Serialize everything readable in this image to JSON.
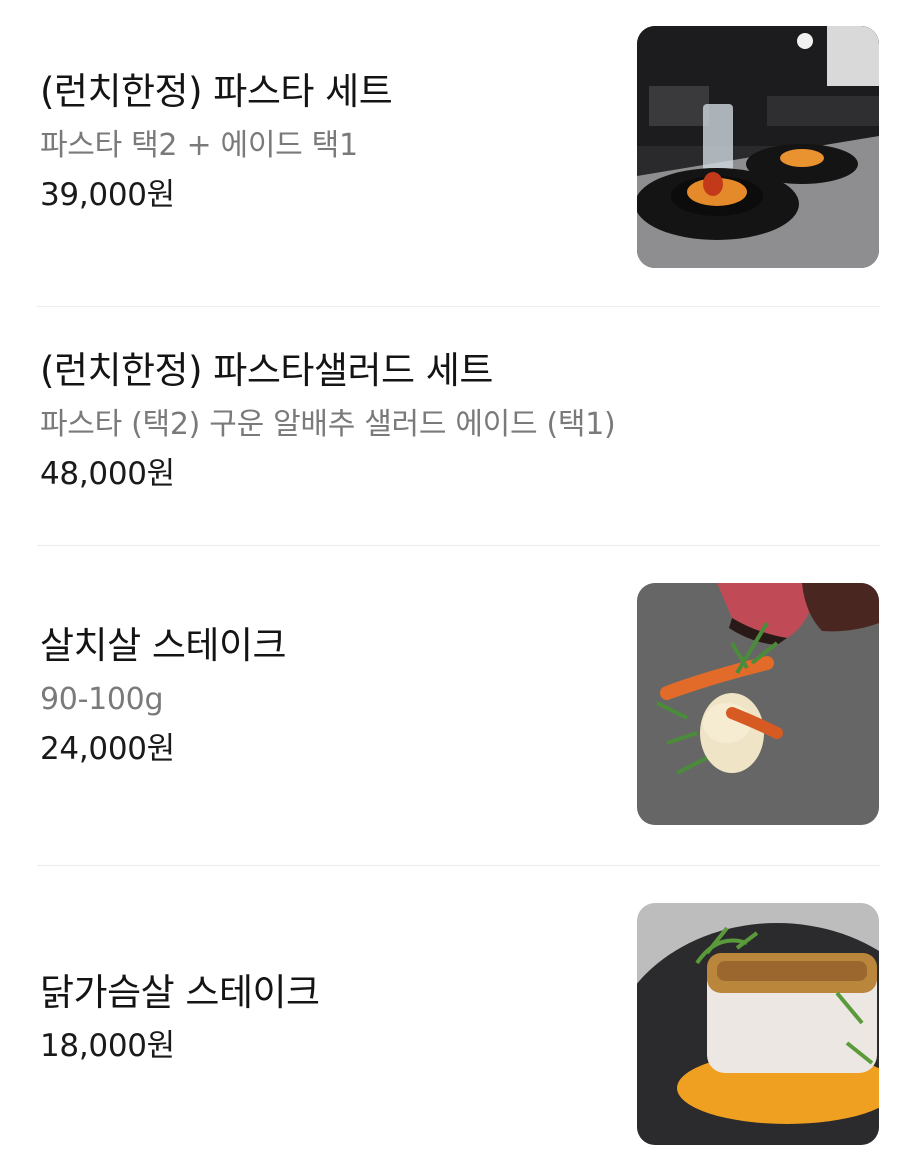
{
  "menu": {
    "items": [
      {
        "name": "(런치한정) 파스타 세트",
        "description": "파스타 택2 + 에이드 택1",
        "price": "39,000원",
        "image": "pasta-set-photo"
      },
      {
        "name": "(런치한정) 파스타샐러드 세트",
        "description": "파스타 (택2) 구운 알배추 샐러드 에이드 (택1)",
        "price": "48,000원",
        "image": null
      },
      {
        "name": "살치살 스테이크",
        "description": "90-100g",
        "price": "24,000원",
        "image": "chuck-flap-steak-photo"
      },
      {
        "name": "닭가슴살 스테이크",
        "description": "",
        "price": "18,000원",
        "image": "chicken-breast-steak-photo"
      }
    ]
  },
  "colors": {
    "text_primary": "#141414",
    "text_secondary": "#7a7a7a",
    "divider": "#ececec",
    "background": "#ffffff"
  }
}
